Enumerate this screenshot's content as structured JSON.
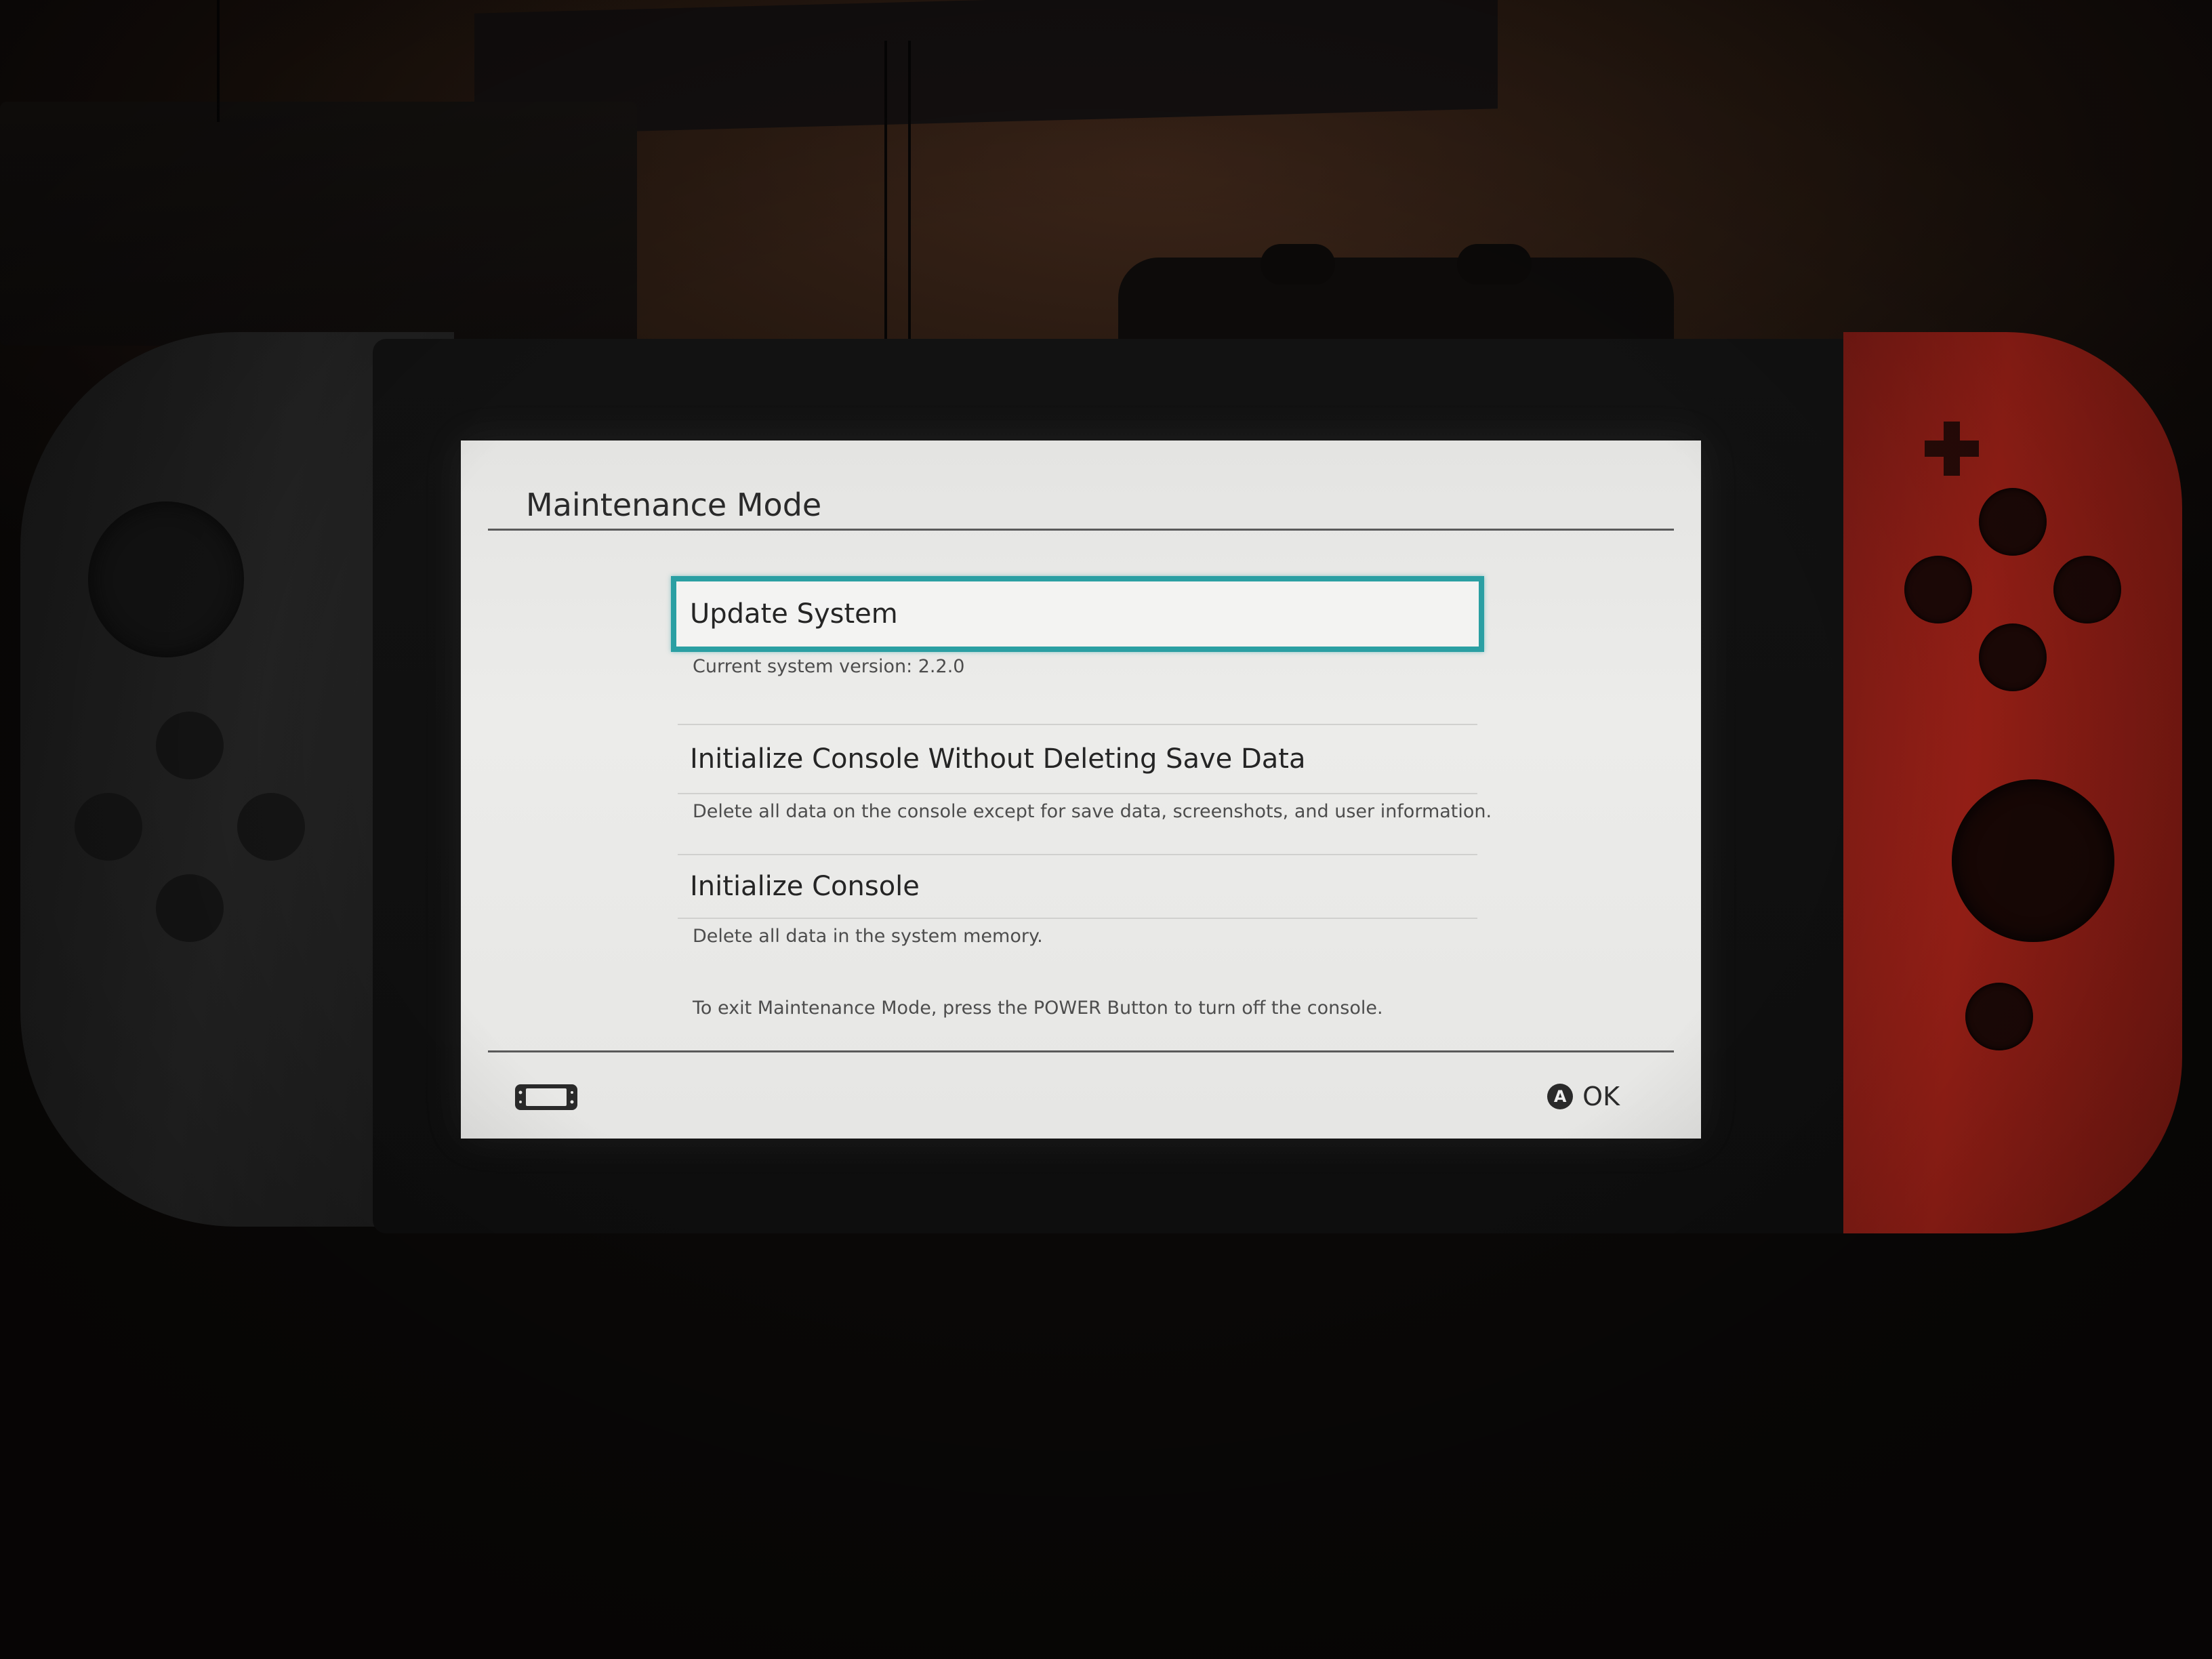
{
  "screen": {
    "title": "Maintenance Mode",
    "menu": [
      {
        "label": "Update System",
        "description": "Current system version: 2.2.0",
        "selected": true
      },
      {
        "label": "Initialize Console Without Deleting Save Data",
        "description": "Delete all data on the console except for save data, screenshots, and user information.",
        "selected": false
      },
      {
        "label": "Initialize Console",
        "description": "Delete all data in the system memory.",
        "selected": false
      }
    ],
    "exit_note": "To exit Maintenance Mode, press the POWER Button to turn off the console.",
    "footer": {
      "console_icon": "handheld-console-icon",
      "ok_glyph": "A",
      "ok_label": "OK"
    }
  },
  "colors": {
    "selection_border": "#2a9fa3",
    "screen_background": "#e8e8e6",
    "right_joycon": "#a42218",
    "left_joycon": "#242424"
  }
}
